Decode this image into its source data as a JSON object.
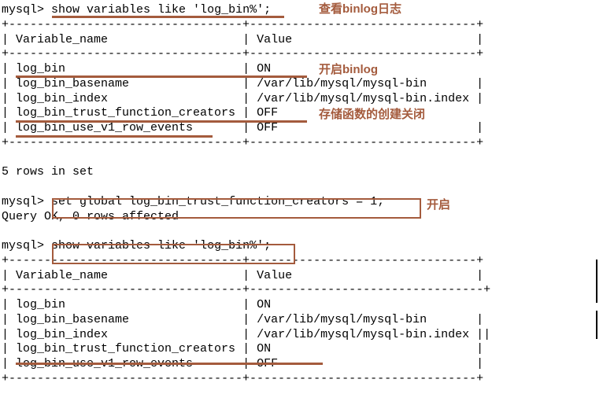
{
  "prompt_text": "mysql>",
  "commands": {
    "cmd1": "show variables like 'log_bin%';",
    "cmd2": "set global log_bin_trust_function_creators = 1;",
    "cmd3": "show variables like 'log_bin%';"
  },
  "headers": {
    "col1": "Variable_name",
    "col2": "Value"
  },
  "table1_rows": [
    {
      "name": "log_bin",
      "value": "ON"
    },
    {
      "name": "log_bin_basename",
      "value": "/var/lib/mysql/mysql-bin"
    },
    {
      "name": "log_bin_index",
      "value": "/var/lib/mysql/mysql-bin.index"
    },
    {
      "name": "log_bin_trust_function_creators",
      "value": "OFF"
    },
    {
      "name": "log_bin_use_v1_row_events",
      "value": "OFF"
    }
  ],
  "result_summary": "5 rows in set",
  "query_ok": "Query OK, 0 rows affected",
  "table2_rows": [
    {
      "name": "log_bin",
      "value": "ON"
    },
    {
      "name": "log_bin_basename",
      "value": "/var/lib/mysql/mysql-bin"
    },
    {
      "name": "log_bin_index",
      "value": "/var/lib/mysql/mysql-bin.index"
    },
    {
      "name": "log_bin_trust_function_creators",
      "value": "ON"
    },
    {
      "name": "log_bin_use_v1_row_events",
      "value": "OFF"
    }
  ],
  "annotations": {
    "a1": "查看binlog日志",
    "a2": "开启binlog",
    "a3": "存储函数的创建关闭",
    "a4": "开启"
  },
  "sep": {
    "full": "+---------------------------------+--------------------------------+",
    "full2": "+---------------------------------+---------------------------------+"
  }
}
